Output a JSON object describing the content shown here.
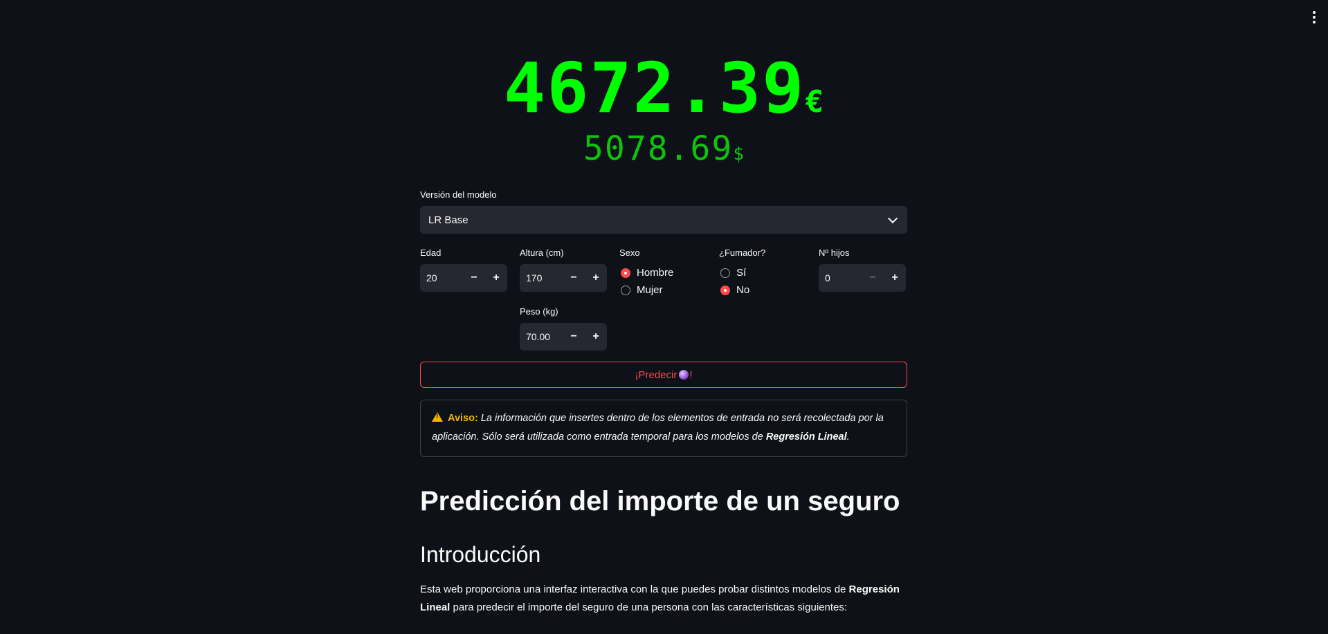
{
  "menu": {
    "icon": "kebab-menu-icon"
  },
  "prediction": {
    "eur_value": "4672.39",
    "eur_symbol": "€",
    "usd_value": "5078.69",
    "usd_symbol": "$",
    "colors": {
      "eur": "#00ff00",
      "usd": "#0ec20e"
    }
  },
  "model_select": {
    "label": "Versión del modelo",
    "value": "LR Base"
  },
  "inputs": {
    "edad": {
      "label": "Edad",
      "value": "20"
    },
    "altura": {
      "label": "Altura (cm)",
      "value": "170"
    },
    "peso": {
      "label": "Peso (kg)",
      "value": "70.00"
    },
    "hijos": {
      "label": "Nº hijos",
      "value": "0"
    },
    "minus": "−",
    "plus": "+"
  },
  "sexo": {
    "label": "Sexo",
    "options": [
      "Hombre",
      "Mujer"
    ],
    "selected": "Hombre"
  },
  "fumador": {
    "label": "¿Fumador?",
    "options": [
      "Sí",
      "No"
    ],
    "selected": "No"
  },
  "predict_button": {
    "label": "¡Predecir ",
    "suffix": "!"
  },
  "alert": {
    "title": "Aviso:",
    "text_1": " La información que insertes dentro de los elementos de entrada no será recolectada por la aplicación. Sólo será utilizada como entrada temporal para los modelos de ",
    "bold": "Regresión Lineal",
    "text_2": "."
  },
  "content": {
    "title": "Predicción del importe de un seguro",
    "section": "Introducción",
    "intro_1": "Esta web proporciona una interfaz interactiva con la que puedes probar distintos modelos de ",
    "intro_bold": "Regresión Lineal",
    "intro_2": " para predecir el importe del seguro de una persona con las características siguientes:"
  },
  "accent_color": "#ff4b4b",
  "background_color": "#0e1117"
}
